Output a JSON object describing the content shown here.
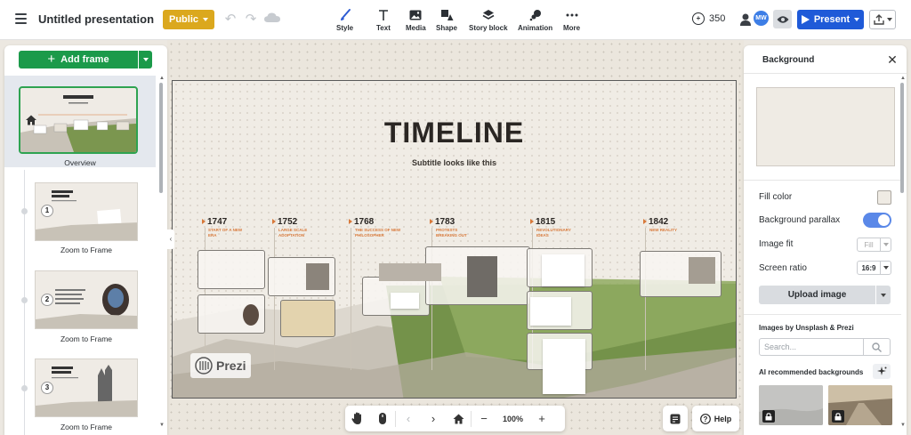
{
  "app": {
    "doc_title": "Untitled presentation",
    "public_label": "Public",
    "credits": "350",
    "avatar_initials": "MW",
    "present_label": "Present"
  },
  "toolbar": {
    "tools": [
      {
        "label": "Style",
        "icon": "brush-icon"
      },
      {
        "label": "Text",
        "icon": "text-icon"
      },
      {
        "label": "Media",
        "icon": "image-icon"
      },
      {
        "label": "Shape",
        "icon": "shape-icon"
      },
      {
        "label": "Story block",
        "icon": "layers-icon"
      },
      {
        "label": "Animation",
        "icon": "animation-icon"
      },
      {
        "label": "More",
        "icon": "more-icon"
      }
    ]
  },
  "left_panel": {
    "add_frame_label": "Add frame",
    "overview_label": "Overview",
    "frames": [
      {
        "number": "1",
        "label": "Zoom to Frame"
      },
      {
        "number": "2",
        "label": "Zoom to Frame"
      },
      {
        "number": "3",
        "label": "Zoom to Frame"
      }
    ]
  },
  "canvas": {
    "title": "TIMELINE",
    "subtitle": "Subtitle looks like this",
    "timeline": [
      {
        "year": "1747",
        "event": "START OF A NEW ERA"
      },
      {
        "year": "1752",
        "event": "LARGE SCALE ADOPTATION"
      },
      {
        "year": "1768",
        "event": "THE SUCCESS OF NEW PHILOSOPHER"
      },
      {
        "year": "1783",
        "event": "PROTESTS BREAKING OUT"
      },
      {
        "year": "1815",
        "event": "REVOLUTIONARY IDEAS"
      },
      {
        "year": "1842",
        "event": "NEW REALITY"
      }
    ],
    "logo_text": "Prezi",
    "zoom": "100%",
    "help_label": "Help"
  },
  "right_panel": {
    "title": "Background",
    "fill_color_label": "Fill color",
    "fill_color": "#efebe4",
    "parallax_label": "Background parallax",
    "parallax_on": true,
    "image_fit_label": "Image fit",
    "image_fit_value": "Fill",
    "screen_ratio_label": "Screen ratio",
    "screen_ratio_value": "16:9",
    "upload_label": "Upload image",
    "images_section": "Images by Unsplash & Prezi",
    "search_placeholder": "Search...",
    "ai_section": "AI recommended backgrounds"
  },
  "colors": {
    "accent_green": "#1b9a4a",
    "public_gold": "#dba81e",
    "present_blue": "#1f5ad8",
    "timeline_orange": "#d8793a",
    "toggle_blue": "#5a88e8"
  }
}
